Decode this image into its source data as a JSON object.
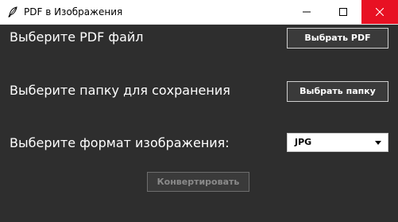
{
  "window": {
    "title": "PDF в Изображения"
  },
  "pdf_row": {
    "label": "Выберите PDF файл",
    "button_label": "Выбрать PDF"
  },
  "folder_row": {
    "label": "Выберите папку для сохранения",
    "button_label": "Выбрать папку"
  },
  "format_row": {
    "label": "Выберите формат изображения:",
    "selected_value": "JPG"
  },
  "convert_button": {
    "label": "Конвертировать",
    "state": "disabled"
  },
  "colors": {
    "background": "#2e2e2e",
    "titlebar": "#ffffff",
    "close_hover": "#e81123",
    "text": "#ffffff",
    "disabled_text": "#8a8a8a"
  }
}
